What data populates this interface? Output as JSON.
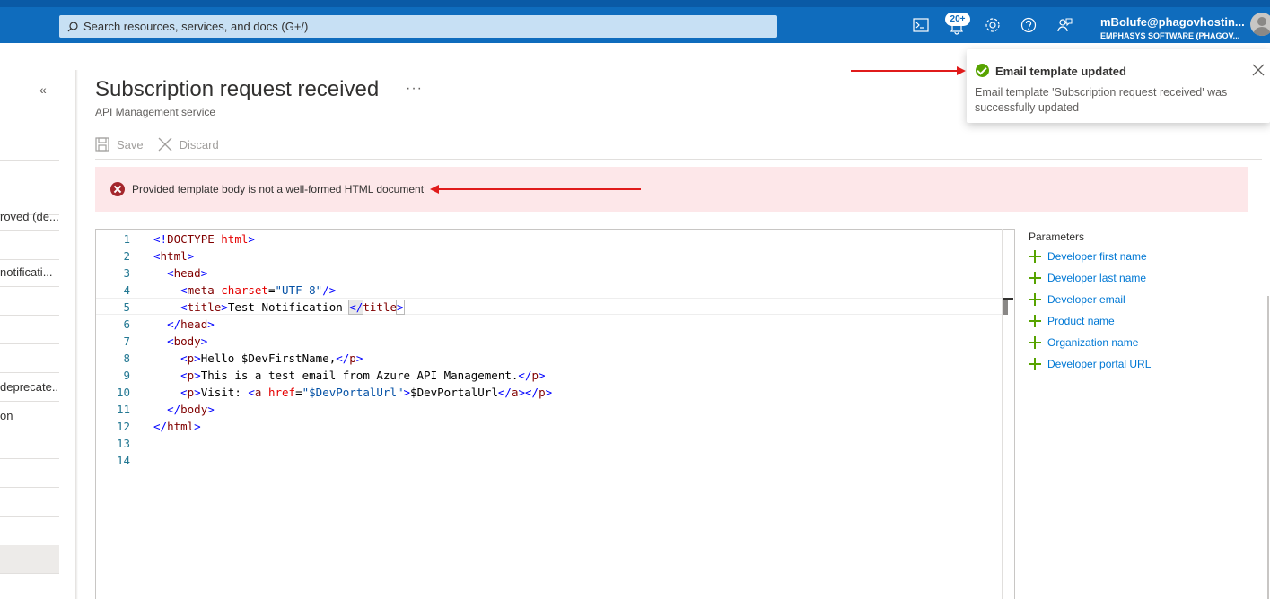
{
  "topbar": {
    "search_placeholder": "Search resources, services, and docs (G+/)",
    "notification_count": "20+",
    "account_name": "mBolufe@phagovhostin...",
    "account_org": "EMPHASYS SOFTWARE (PHAGOV...",
    "icons": [
      "cloud-shell-icon",
      "notifications-icon",
      "settings-icon",
      "help-icon",
      "feedback-icon"
    ]
  },
  "leftnav": {
    "collapse_glyph": "«",
    "items": [
      {
        "label": ""
      },
      {
        "label": "roved (de..."
      },
      {
        "label": ""
      },
      {
        "label": " notificati..."
      },
      {
        "label": ""
      },
      {
        "label": ""
      },
      {
        "label": ""
      },
      {
        "label": "deprecate..."
      },
      {
        "label": "on"
      },
      {
        "label": ""
      },
      {
        "label": ""
      },
      {
        "label": ""
      },
      {
        "label": ""
      }
    ]
  },
  "page": {
    "title": "Subscription request received",
    "more": "···",
    "subtitle": "API Management service"
  },
  "commandbar": {
    "save_label": "Save",
    "discard_label": "Discard"
  },
  "error": {
    "message": "Provided template body is not a well-formed HTML document"
  },
  "editor": {
    "current_line": 5,
    "line_numbers": [
      "1",
      "2",
      "3",
      "4",
      "5",
      "6",
      "7",
      "8",
      "9",
      "10",
      "11",
      "12",
      "13",
      "14"
    ]
  },
  "parameters": {
    "title": "Parameters",
    "items": [
      "Developer first name",
      "Developer last name",
      "Developer email",
      "Product name",
      "Organization name",
      "Developer portal URL"
    ]
  },
  "toast": {
    "title": "Email template updated",
    "body": "Email template 'Subscription request received' was successfully updated"
  },
  "colors": {
    "topbar": "#0f6cbd",
    "error_bg": "#fde7e9",
    "error_icon": "#a4262c",
    "success": "#57a300",
    "link": "#0078d4",
    "annotation_arrow": "#e01b1b"
  }
}
